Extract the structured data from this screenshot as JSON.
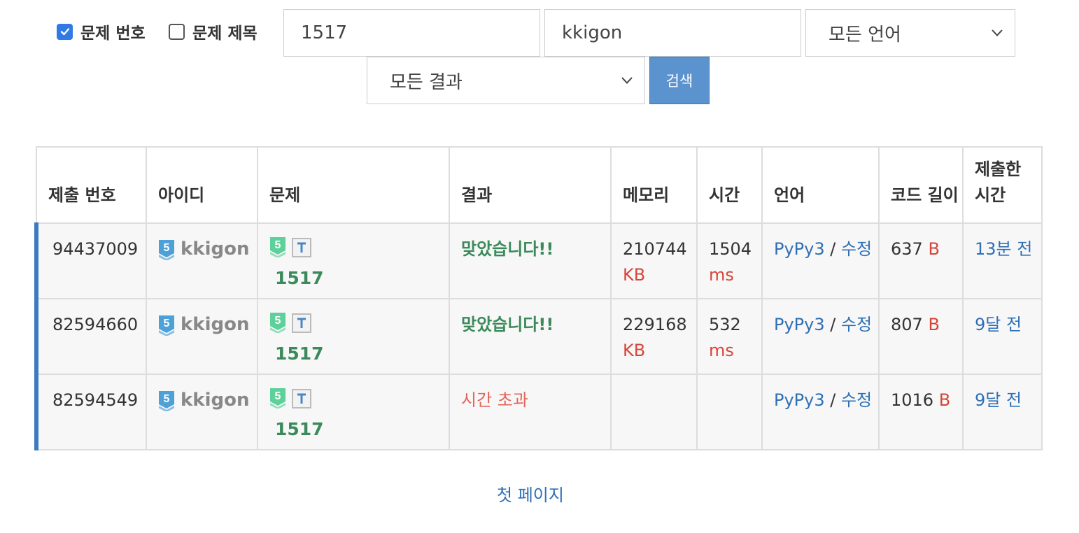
{
  "filters": {
    "problem_number_checkbox": {
      "label": "문제 번호",
      "checked": true
    },
    "problem_title_checkbox": {
      "label": "문제 제목",
      "checked": false
    },
    "problem_input": {
      "value": "1517"
    },
    "user_input": {
      "value": "kkigon"
    },
    "language_select": {
      "selected": "모든 언어"
    },
    "result_select": {
      "selected": "모든 결과"
    },
    "search_label": "검색"
  },
  "table": {
    "headers": {
      "submission_id": "제출 번호",
      "user_id": "아이디",
      "problem": "문제",
      "result": "결과",
      "memory": "메모리",
      "time": "시간",
      "language": "언어",
      "code_length": "코드 길이",
      "submitted_at": "제출한 시간"
    },
    "rows": [
      {
        "id": "94437009",
        "user": "kkigon",
        "tier_level": "5",
        "problem": "1517",
        "result": "맞았습니다!!",
        "memory": "210744",
        "memory_unit": "KB",
        "time": "1504",
        "time_unit": "ms",
        "language": "PyPy3",
        "edit": "수정",
        "length": "637",
        "length_unit": "B",
        "submitted": "13분 전"
      },
      {
        "id": "82594660",
        "user": "kkigon",
        "tier_level": "5",
        "problem": "1517",
        "result": "맞았습니다!!",
        "memory": "229168",
        "memory_unit": "KB",
        "time": "532",
        "time_unit": "ms",
        "language": "PyPy3",
        "edit": "수정",
        "length": "807",
        "length_unit": "B",
        "submitted": "9달 전"
      },
      {
        "id": "82594549",
        "user": "kkigon",
        "tier_level": "5",
        "problem": "1517",
        "result": "시간 초과",
        "memory": "",
        "memory_unit": "",
        "time": "",
        "time_unit": "",
        "language": "PyPy3",
        "edit": "수정",
        "length": "1016",
        "length_unit": "B",
        "submitted": "9달 전"
      }
    ]
  },
  "pagination": {
    "first_page": "첫 페이지"
  },
  "colors": {
    "accent": "#2f7ae5",
    "button": "#5b93cf",
    "success": "#3c8a5c",
    "error": "#e3655a",
    "unit": "#d6453a",
    "link": "#2f6fb5",
    "row_marker": "#3b7bbf"
  },
  "icons": {
    "tier": "tier-badge-icon",
    "tag": "tag-t-icon",
    "dropdown": "chevron-down-icon",
    "check": "check-icon"
  }
}
